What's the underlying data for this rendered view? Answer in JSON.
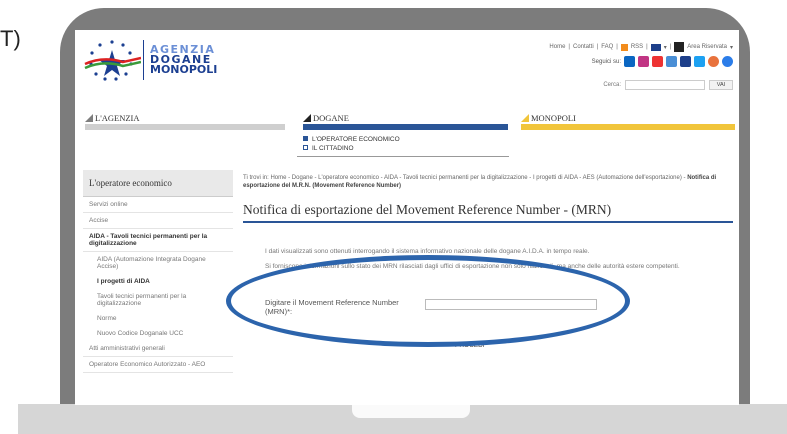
{
  "fragment": "T)",
  "header": {
    "agency_name": [
      "AGENZIA",
      "DOGANE",
      "MONOPOLI"
    ],
    "topnav": [
      "Home",
      "Contatti",
      "FAQ",
      "RSS",
      "Area Riservata"
    ],
    "follow_label": "Seguici su:",
    "search_label": "Cerca:",
    "search_button": "VAI"
  },
  "sections": [
    "L'AGENZIA",
    "DOGANE",
    "MONOPOLI"
  ],
  "subnav": [
    "L'OPERATORE ECONOMICO",
    "IL CITTADINO"
  ],
  "sidebar": {
    "title": "L'operatore economico",
    "items": [
      "Servizi online",
      "Accise",
      "AIDA - Tavoli tecnici permanenti per la digitalizzazione",
      "AIDA (Automazione Integrata Dogane Accise)",
      "I progetti di AIDA",
      "Tavoli tecnici permanenti per la digitalizzazione",
      "Norme",
      "Nuovo Codice Doganale UCC",
      "Atti amministrativi generali",
      "Operatore Economico Autorizzato - AEO"
    ]
  },
  "breadcrumb": {
    "prefix": "Ti trovi in:",
    "path": "Home - Dogane - L'operatore economico - AIDA - Tavoli tecnici permanenti per la digitalizzazione - I progetti di AIDA - AES (Automazione dell'esportazione) -",
    "current": "Notifica di esportazione del M.R.N. (Movement Reference Number)"
  },
  "main": {
    "title": "Notifica di esportazione del Movement Reference Number - (MRN)",
    "p1": "I dati visualizzati sono ottenuti interrogando il sistema informativo nazionale delle dogane A.I.D.A. in tempo reale.",
    "p2": "Si forniscono informazioni sullo stato dei MRN rilasciati dagli uffici di esportazione non solo nazionali, ma anche delle autorità estere competenti.",
    "mrn_label": "Digitare il Movement Reference Number (MRN)*:",
    "submit": "PROCEDI"
  }
}
